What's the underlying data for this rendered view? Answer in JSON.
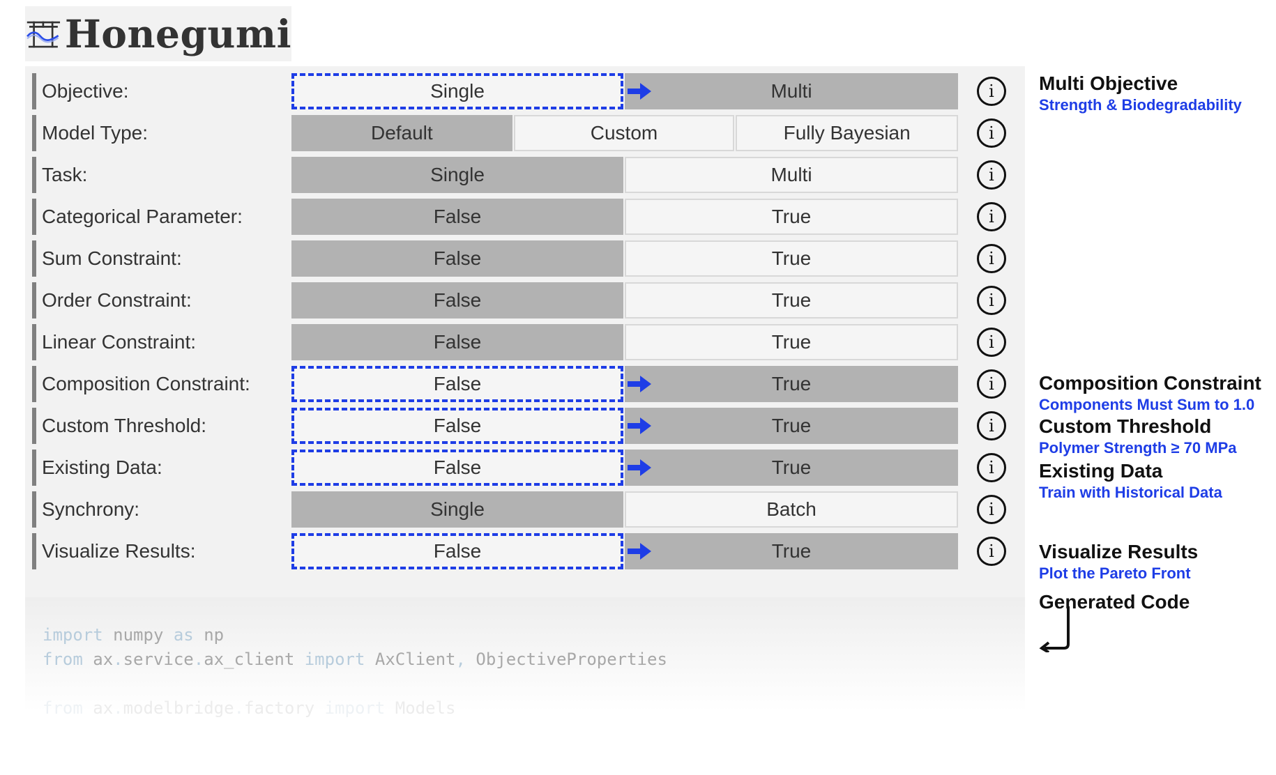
{
  "app": {
    "name": "Honegumi"
  },
  "options": [
    {
      "label": "Objective:",
      "choices": [
        "Single",
        "Multi"
      ],
      "selected": 1,
      "highlighted": true
    },
    {
      "label": "Model Type:",
      "choices": [
        "Default",
        "Custom",
        "Fully Bayesian"
      ],
      "selected": 0,
      "highlighted": false
    },
    {
      "label": "Task:",
      "choices": [
        "Single",
        "Multi"
      ],
      "selected": 0,
      "highlighted": false
    },
    {
      "label": "Categorical Parameter:",
      "choices": [
        "False",
        "True"
      ],
      "selected": 0,
      "highlighted": false
    },
    {
      "label": "Sum Constraint:",
      "choices": [
        "False",
        "True"
      ],
      "selected": 0,
      "highlighted": false
    },
    {
      "label": "Order Constraint:",
      "choices": [
        "False",
        "True"
      ],
      "selected": 0,
      "highlighted": false
    },
    {
      "label": "Linear Constraint:",
      "choices": [
        "False",
        "True"
      ],
      "selected": 0,
      "highlighted": false
    },
    {
      "label": "Composition Constraint:",
      "choices": [
        "False",
        "True"
      ],
      "selected": 1,
      "highlighted": true
    },
    {
      "label": "Custom Threshold:",
      "choices": [
        "False",
        "True"
      ],
      "selected": 1,
      "highlighted": true
    },
    {
      "label": "Existing Data:",
      "choices": [
        "False",
        "True"
      ],
      "selected": 1,
      "highlighted": true
    },
    {
      "label": "Synchrony:",
      "choices": [
        "Single",
        "Batch"
      ],
      "selected": 0,
      "highlighted": false
    },
    {
      "label": "Visualize Results:",
      "choices": [
        "False",
        "True"
      ],
      "selected": 1,
      "highlighted": true
    }
  ],
  "info_glyph": "i",
  "code": {
    "lines": [
      [
        [
          "kw",
          "import"
        ],
        [
          "tx",
          " numpy "
        ],
        [
          "kw",
          "as"
        ],
        [
          "tx",
          " np"
        ]
      ],
      [
        [
          "kw",
          "from"
        ],
        [
          "tx",
          " ax"
        ],
        [
          "kw",
          "."
        ],
        [
          "tx",
          "service"
        ],
        [
          "kw",
          "."
        ],
        [
          "tx",
          "ax_client "
        ],
        [
          "kw",
          "import"
        ],
        [
          "tx",
          " AxClient"
        ],
        [
          "kw",
          ","
        ],
        [
          "tx",
          " ObjectiveProperties"
        ]
      ],
      [],
      [
        [
          "kw",
          "from"
        ],
        [
          "tx",
          " ax"
        ],
        [
          "kw",
          "."
        ],
        [
          "tx",
          "modelbridge"
        ],
        [
          "kw",
          "."
        ],
        [
          "tx",
          "factory "
        ],
        [
          "kw",
          "import"
        ],
        [
          "tx",
          " Models"
        ]
      ]
    ]
  },
  "annotations": [
    {
      "title": "Multi Objective",
      "subtitle": "Strength & Biodegradability"
    },
    {
      "title": "Composition Constraint",
      "subtitle": "Components Must Sum to 1.0"
    },
    {
      "title": "Custom Threshold",
      "subtitle": "Polymer Strength ≥ 70 MPa"
    },
    {
      "title": "Existing Data",
      "subtitle": "Train with Historical Data"
    },
    {
      "title": "Visualize Results",
      "subtitle": "Plot the Pareto Front"
    },
    {
      "title": "Generated Code",
      "subtitle": ""
    }
  ],
  "colors": {
    "accent": "#1e3de6",
    "selected": "#b2b2b2",
    "panel": "#f2f2f2"
  },
  "icons": {
    "logo": "torii-gate-logo",
    "info": "info-icon",
    "arrow": "right-arrow-icon",
    "return": "return-arrow-icon"
  }
}
